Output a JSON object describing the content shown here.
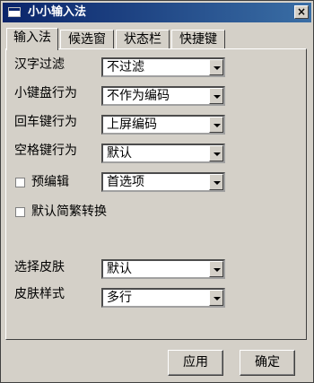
{
  "window": {
    "title": "小小输入法",
    "close_glyph": "×"
  },
  "tabs": [
    {
      "label": "输入法",
      "active": true
    },
    {
      "label": "候选窗",
      "active": false
    },
    {
      "label": "状态栏",
      "active": false
    },
    {
      "label": "快捷键",
      "active": false
    }
  ],
  "settings": {
    "hanzi_filter": {
      "label": "汉字过滤",
      "value": "不过滤"
    },
    "keypad_behavior": {
      "label": "小键盘行为",
      "value": "不作为编码"
    },
    "enter_behavior": {
      "label": "回车键行为",
      "value": "上屏编码"
    },
    "space_behavior": {
      "label": "空格键行为",
      "value": "默认"
    },
    "pre_edit": {
      "label": "预编辑",
      "checked": false,
      "value": "首选项"
    },
    "trad_simp_convert": {
      "label": "默认简繁转换",
      "checked": false
    },
    "skin": {
      "label": "选择皮肤",
      "value": "默认"
    },
    "skin_style": {
      "label": "皮肤样式",
      "value": "多行"
    }
  },
  "buttons": {
    "apply": "应用",
    "ok": "确定"
  }
}
